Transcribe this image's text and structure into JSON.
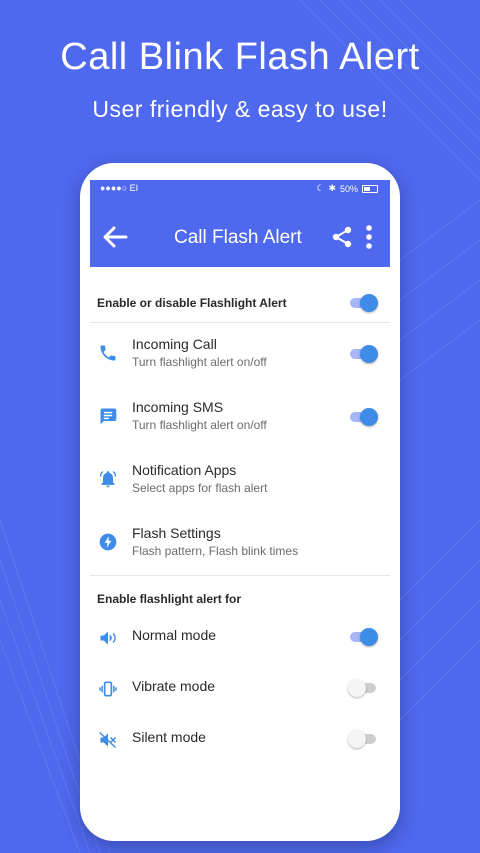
{
  "promo": {
    "headline": "Call Blink Flash Alert",
    "subline": "User friendly & easy to use!"
  },
  "colors": {
    "background": "#4e68ee",
    "appbar": "#4e68ee",
    "icon_blue": "#3f8ce8",
    "toggle_on": "#3f8ce8"
  },
  "statusbar": {
    "carrier": "●●●●○ EI",
    "battery": "50%"
  },
  "appbar": {
    "title": "Call Flash Alert",
    "back_icon": "arrow-back-icon",
    "share_icon": "share-icon",
    "more_icon": "more-vert-icon"
  },
  "main_switch": {
    "label": "Enable or disable Flashlight Alert",
    "on": true
  },
  "items": [
    {
      "title": "Incoming Call",
      "subtitle": "Turn flashlight alert on/off",
      "icon": "phone-icon",
      "toggle": true,
      "on": true
    },
    {
      "title": "Incoming SMS",
      "subtitle": "Turn flashlight alert on/off",
      "icon": "message-icon",
      "toggle": true,
      "on": true
    },
    {
      "title": "Notification Apps",
      "subtitle": "Select apps for flash alert",
      "icon": "bell-ring-icon",
      "toggle": false
    },
    {
      "title": "Flash Settings",
      "subtitle": "Flash pattern, Flash blink times",
      "icon": "flash-icon",
      "toggle": false
    }
  ],
  "modes_section": {
    "label": "Enable flashlight alert for",
    "modes": [
      {
        "title": "Normal mode",
        "icon": "volume-icon",
        "on": true
      },
      {
        "title": "Vibrate mode",
        "icon": "vibrate-icon",
        "on": false
      },
      {
        "title": "Silent mode",
        "icon": "volume-off-icon",
        "on": false
      }
    ]
  }
}
